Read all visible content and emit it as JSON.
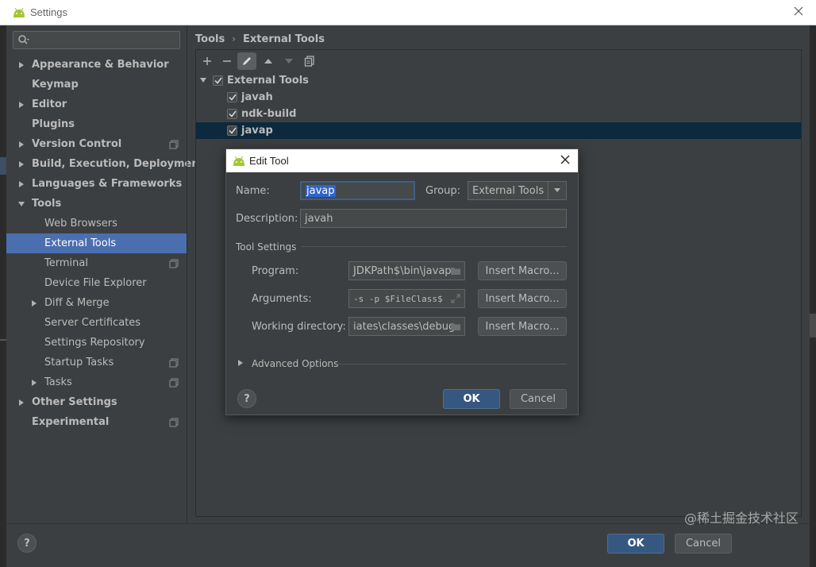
{
  "window": {
    "title": "Settings",
    "search_placeholder": ""
  },
  "sidebar": {
    "items": [
      {
        "label": "Appearance & Behavior",
        "expandable": true,
        "expanded": false,
        "level": 0
      },
      {
        "label": "Keymap",
        "expandable": false,
        "level": 0
      },
      {
        "label": "Editor",
        "expandable": true,
        "expanded": false,
        "level": 0
      },
      {
        "label": "Plugins",
        "expandable": false,
        "level": 0
      },
      {
        "label": "Version Control",
        "expandable": true,
        "expanded": false,
        "level": 0,
        "project_icon": true
      },
      {
        "label": "Build, Execution, Deployment",
        "expandable": true,
        "expanded": false,
        "level": 0
      },
      {
        "label": "Languages & Frameworks",
        "expandable": true,
        "expanded": false,
        "level": 0
      },
      {
        "label": "Tools",
        "expandable": true,
        "expanded": true,
        "level": 0
      },
      {
        "label": "Web Browsers",
        "level": 1
      },
      {
        "label": "External Tools",
        "level": 1,
        "selected": true
      },
      {
        "label": "Terminal",
        "level": 1,
        "project_icon": true
      },
      {
        "label": "Device File Explorer",
        "level": 1
      },
      {
        "label": "Diff & Merge",
        "level": 1,
        "expandable": true,
        "expanded": false
      },
      {
        "label": "Server Certificates",
        "level": 1
      },
      {
        "label": "Settings Repository",
        "level": 1
      },
      {
        "label": "Startup Tasks",
        "level": 1,
        "project_icon": true
      },
      {
        "label": "Tasks",
        "level": 1,
        "expandable": true,
        "expanded": false,
        "project_icon": true
      },
      {
        "label": "Other Settings",
        "expandable": true,
        "expanded": false,
        "level": 0
      },
      {
        "label": "Experimental",
        "expandable": false,
        "level": 0,
        "project_icon": true
      }
    ]
  },
  "breadcrumb": {
    "part1": "Tools",
    "separator": "›",
    "part2": "External Tools"
  },
  "toolbar": {
    "buttons": [
      "add-icon",
      "remove-icon",
      "edit-icon",
      "move-up-icon",
      "move-down-icon",
      "copy-icon"
    ]
  },
  "tools_list": {
    "group": {
      "label": "External Tools",
      "checked": true,
      "expanded": true
    },
    "items": [
      {
        "label": "javah",
        "checked": true
      },
      {
        "label": "ndk-build",
        "checked": true
      },
      {
        "label": "javap",
        "checked": true,
        "selected": true
      }
    ]
  },
  "dialog": {
    "title": "Edit Tool",
    "name_label": "Name:",
    "name_value": "javap",
    "group_label": "Group:",
    "group_value": "External Tools",
    "description_label": "Description:",
    "description_value": "javah",
    "tool_settings_title": "Tool Settings",
    "program_label": "Program:",
    "program_value": "JDKPath$\\bin\\javap",
    "arguments_label": "Arguments:",
    "arguments_value": "-s -p $FileClass$",
    "working_dir_label": "Working directory:",
    "working_dir_value": "iates\\classes\\debug",
    "insert_macro_label": "Insert Macro...",
    "advanced_options_label": "Advanced Options",
    "help_label": "?",
    "ok_label": "OK",
    "cancel_label": "Cancel"
  },
  "bottom": {
    "help_label": "?",
    "ok_label": "OK",
    "cancel_label": "Cancel"
  },
  "watermark": "@稀土掘金技术社区",
  "colors": {
    "background": "#3c3f41",
    "selection": "#4b6eaf",
    "list_selection": "#0d293e",
    "primary_button": "#365880",
    "text_selection": "#2f65ca",
    "android_green": "#a4c639"
  }
}
